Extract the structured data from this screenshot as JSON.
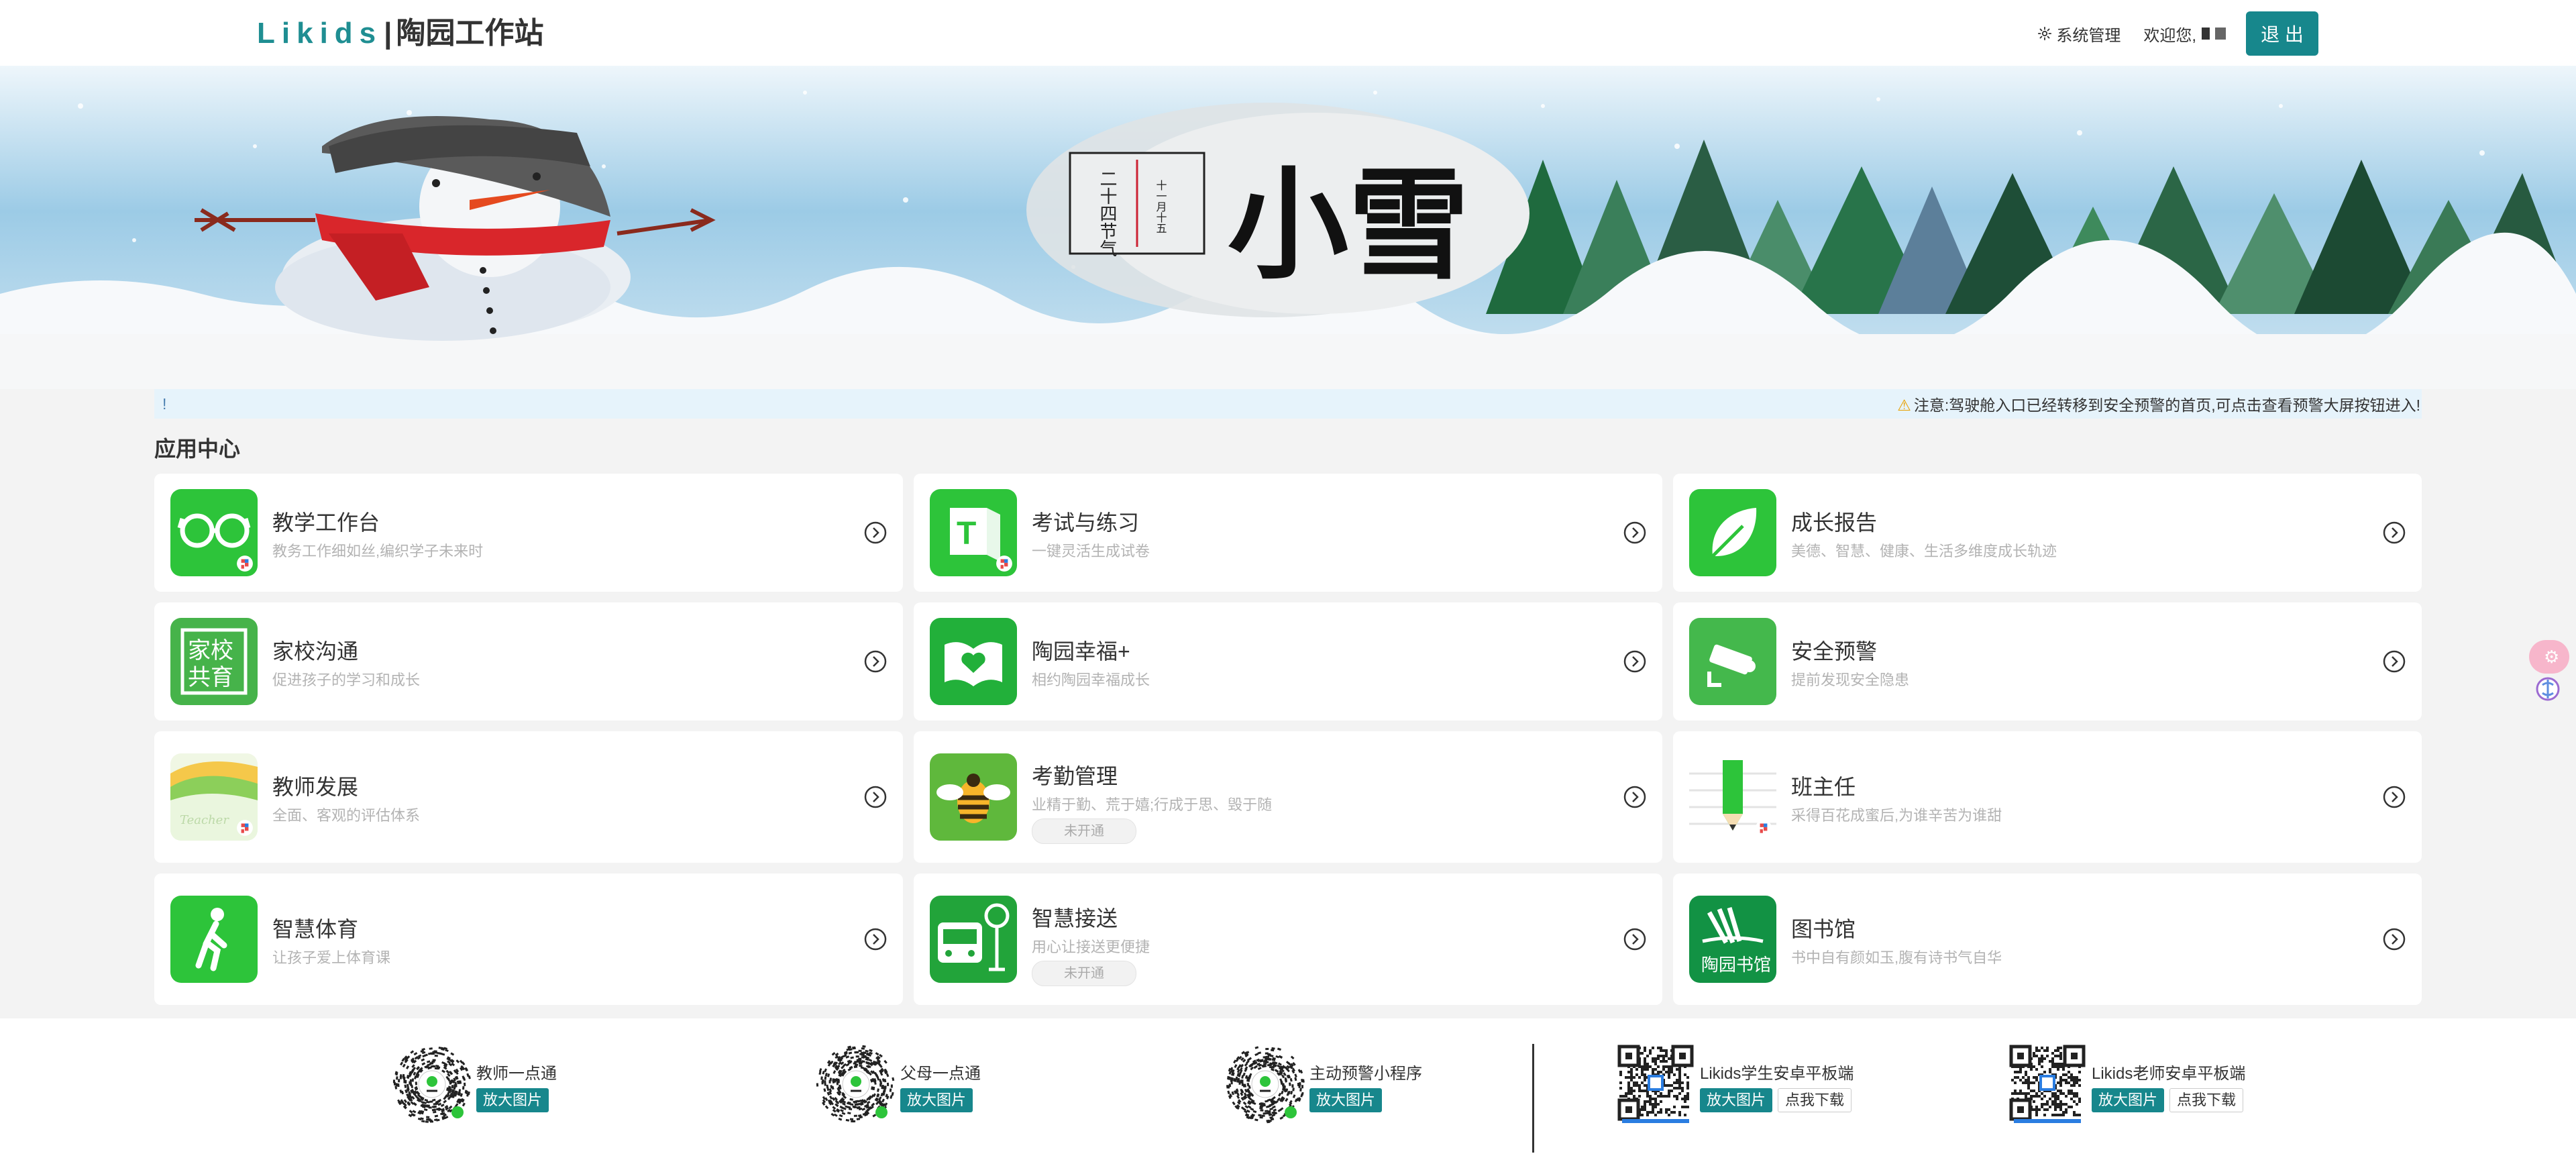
{
  "header": {
    "brand": "Likids",
    "separator": "|",
    "station": "陶园工作站",
    "system_label": "系统管理",
    "welcome_label": "欢迎您,",
    "logout_label": "退 出"
  },
  "banner": {
    "calendar_vertical": "二十四节气",
    "calendar_date": "十一月十五",
    "term": "小雪"
  },
  "notice": {
    "prefix": "!",
    "message": "注意:驾驶舱入口已经转移到安全预警的首页,可点击查看预警大屏按钮进入!"
  },
  "section": {
    "title": "应用中心"
  },
  "apps": [
    {
      "title": "教学工作台",
      "desc": "教务工作细如丝,编织学子未来时",
      "icon": "glasses-icon",
      "badge": ""
    },
    {
      "title": "考试与练习",
      "desc": "一键灵活生成试卷",
      "icon": "exam-book-icon",
      "badge": ""
    },
    {
      "title": "成长报告",
      "desc": "美德、智慧、健康、生活多维度成长轨迹",
      "icon": "leaf-icon",
      "badge": ""
    },
    {
      "title": "家校沟通",
      "desc": "促进孩子的学习和成长",
      "icon": "family-school-icon",
      "badge": ""
    },
    {
      "title": "陶园幸福+",
      "desc": "相约陶园幸福成长",
      "icon": "heart-book-icon",
      "badge": ""
    },
    {
      "title": "安全预警",
      "desc": "提前发现安全隐患",
      "icon": "camera-icon",
      "badge": ""
    },
    {
      "title": "教师发展",
      "desc": "全面、客观的评估体系",
      "icon": "folders-icon",
      "badge": ""
    },
    {
      "title": "考勤管理",
      "desc": "业精于勤、荒于嬉;行成于思、毁于随",
      "icon": "bee-icon",
      "badge": "未开通"
    },
    {
      "title": "班主任",
      "desc": "采得百花成蜜后,为谁辛苦为谁甜",
      "icon": "pencil-icon",
      "badge": ""
    },
    {
      "title": "智慧体育",
      "desc": "让孩子爱上体育课",
      "icon": "walking-icon",
      "badge": ""
    },
    {
      "title": "智慧接送",
      "desc": "用心让接送更便捷",
      "icon": "bus-stop-icon",
      "badge": "未开通"
    },
    {
      "title": "图书馆",
      "desc": "书中自有颜如玉,腹有诗书气自华",
      "icon": "library-icon",
      "badge": ""
    }
  ],
  "footer": {
    "items": [
      {
        "label": "教师一点通",
        "view": "放大图片",
        "download": ""
      },
      {
        "label": "父母一点通",
        "view": "放大图片",
        "download": ""
      },
      {
        "label": "主动预警小程序",
        "view": "放大图片",
        "download": ""
      },
      {
        "label": "Likids学生安卓平板端",
        "view": "放大图片",
        "download": "点我下载"
      },
      {
        "label": "Likids老师安卓平板端",
        "view": "放大图片",
        "download": "点我下载"
      }
    ]
  },
  "colors": {
    "accent": "#17878c",
    "brand": "#1f8e92",
    "app_green": "#2dc43a",
    "notice_bg": "#e6f3fb"
  }
}
